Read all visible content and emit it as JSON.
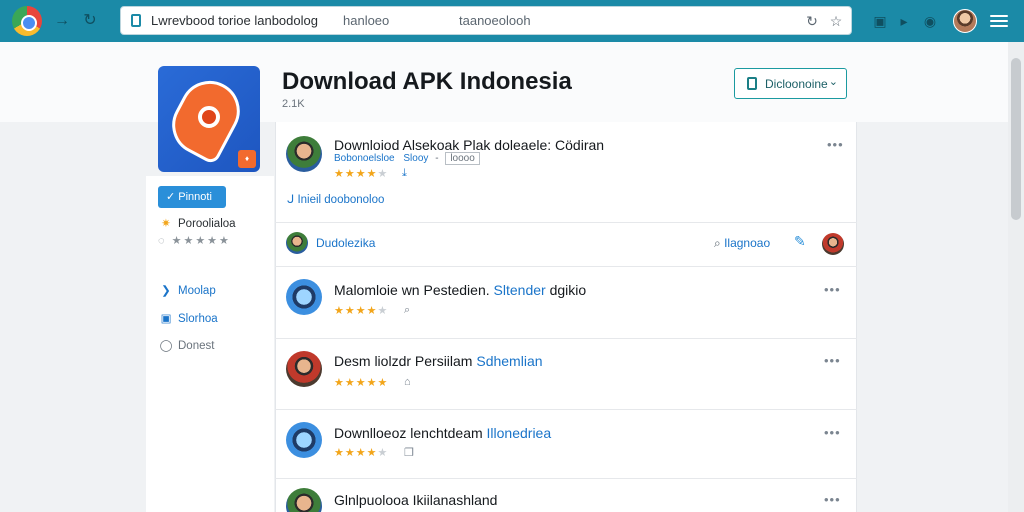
{
  "browser": {
    "address_text": "Lwrevbood torioe lanbodolog",
    "address_mid": "hanloeo",
    "address_right": "taanoeolooh"
  },
  "header": {
    "title": "Download APK Indonesia",
    "count": "2.1K",
    "dropdown_label": "Dicloonoine"
  },
  "sidebar": {
    "follow_label": "Pinnoti",
    "highlight_label": "Poroolialoa",
    "nav": [
      {
        "label": "Moolap",
        "icon": "twitter-icon"
      },
      {
        "label": "Slorhoa",
        "icon": "facebook-icon"
      },
      {
        "label": "Donest",
        "icon": "circle-icon"
      }
    ]
  },
  "feed": {
    "first": {
      "title": "Downloiod Alsekoak Plak doleaele: Cödiran",
      "sub_link": "Bobonoelsloe",
      "sub_mid": "Slooy",
      "sub_tag": "loooo",
      "info": "Inieil doobonoloo"
    },
    "user_row": {
      "name": "Dudolezika",
      "search_label": "Ilagnoao"
    },
    "items": [
      {
        "title": "Malomloie wn Pestedien.",
        "title_hl": "Sltender",
        "title_end": "dgikio"
      },
      {
        "title": "Desm liolzdr Persiilam",
        "title_hl": "Sdhemlian",
        "title_end": ""
      },
      {
        "title": "Downlloeoz lenchtdeam",
        "title_hl": "Illonedriea",
        "title_end": ""
      },
      {
        "title": "Glnlpuolooa Ikiilanashland",
        "title_hl": "",
        "title_end": ""
      }
    ]
  },
  "colors": {
    "chrome_bar": "#1b8aa7",
    "link_blue": "#1a74c9",
    "star_gold": "#f2a51a",
    "follow_blue": "#2a8fd9"
  }
}
